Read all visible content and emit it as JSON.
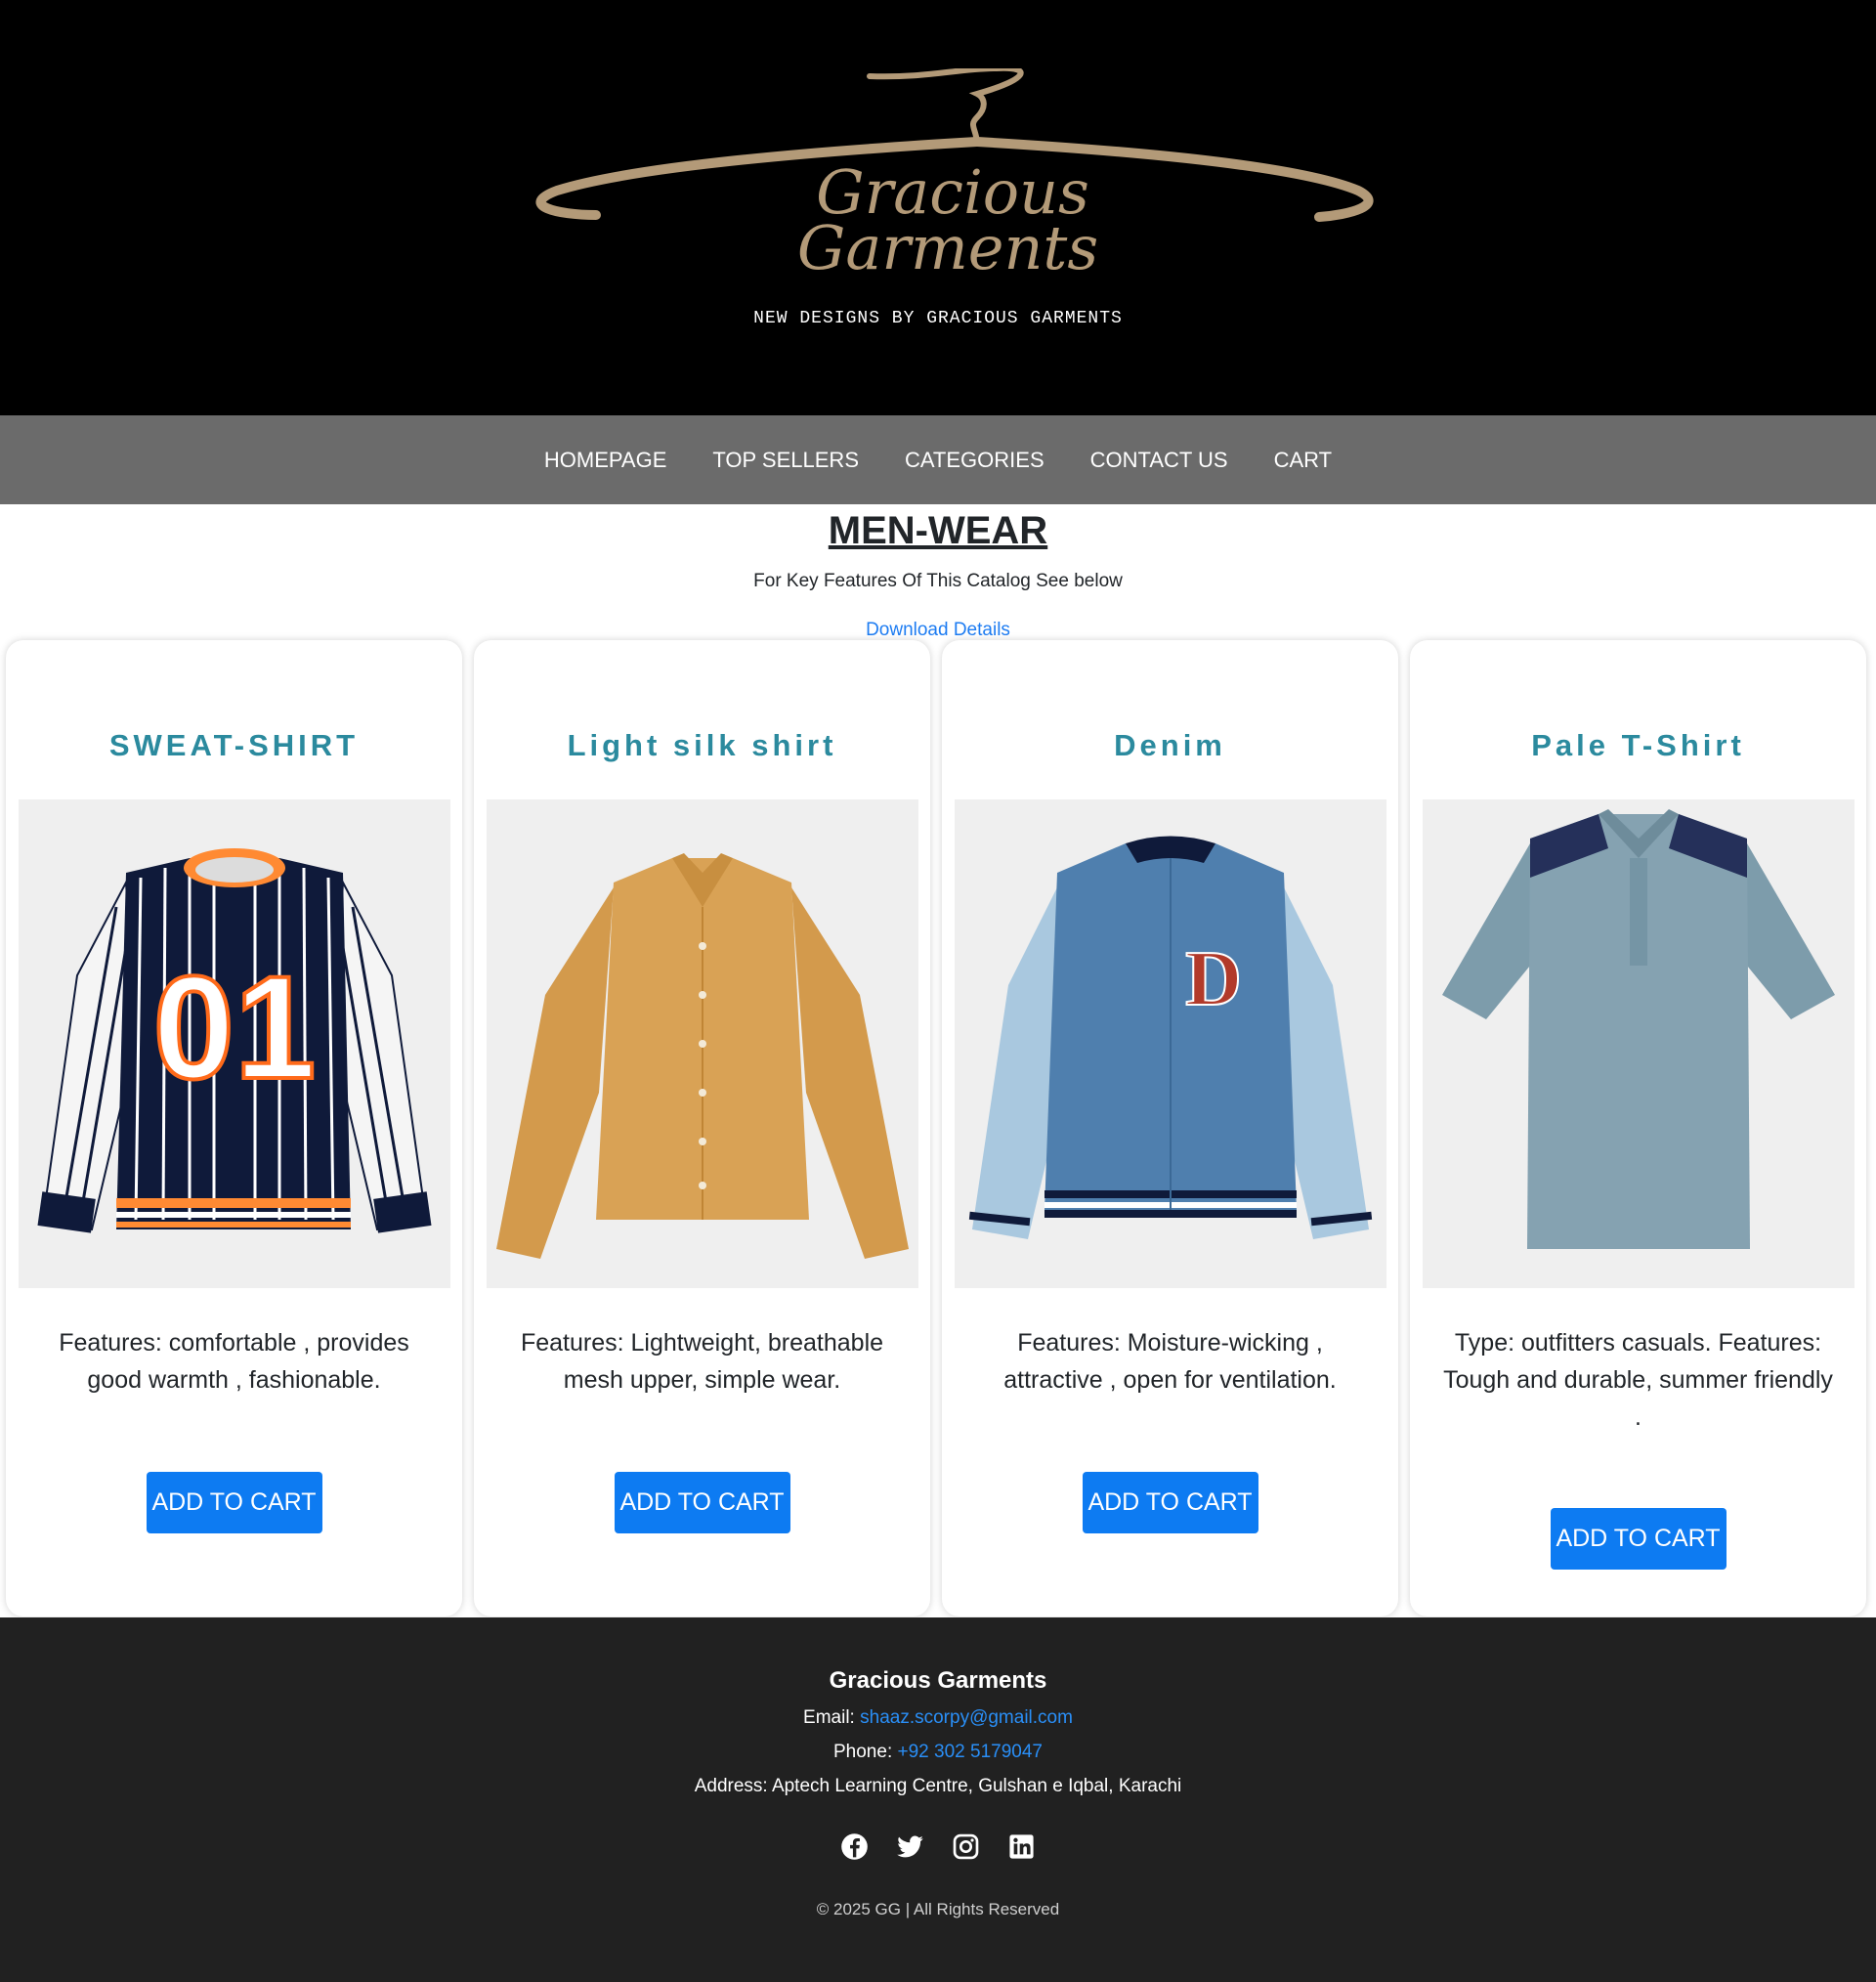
{
  "header": {
    "logo_line1": "Gracious",
    "logo_line2": "Garments",
    "tagline": "NEW DESIGNS BY GRACIOUS GARMENTS",
    "logo_color": "#b39a78"
  },
  "nav": {
    "items": [
      "HOMEPAGE",
      "TOP SELLERS",
      "CATEGORIES",
      "CONTACT US",
      "CART"
    ]
  },
  "section": {
    "title": "MEN-WEAR",
    "subtitle": "For Key Features Of This Catalog See below",
    "download_label": "Download Details"
  },
  "products": [
    {
      "title": "SWEAT-SHIRT",
      "features": "Features: comfortable , provides good warmth , fashionable.",
      "button": "ADD TO CART"
    },
    {
      "title": "Light silk shirt",
      "features": "Features: Lightweight, breathable mesh upper, simple wear.",
      "button": "ADD TO CART"
    },
    {
      "title": "Denim",
      "features": "Features: Moisture-wicking , attractive , open for ventilation.",
      "button": "ADD TO CART"
    },
    {
      "title": "Pale T-Shirt",
      "features": "Type: outfitters casuals. Features: Tough and durable, summer friendly .",
      "button": "ADD TO CART"
    }
  ],
  "footer": {
    "brand": "Gracious Garments",
    "email_label": "Email:",
    "email": "shaaz.scorpy@gmail.com",
    "phone_label": "Phone:",
    "phone": "+92 302 5179047",
    "address": "Address: Aptech Learning Centre, Gulshan e Iqbal, Karachi",
    "social": [
      "facebook-icon",
      "twitter-icon",
      "instagram-icon",
      "linkedin-icon"
    ],
    "copyright": "© 2025 GG | All Rights Reserved"
  },
  "colors": {
    "accent_blue": "#0d7bf2",
    "card_title": "#2b8a9e",
    "nav_bg": "#6b6b6b",
    "footer_bg": "#212121"
  }
}
